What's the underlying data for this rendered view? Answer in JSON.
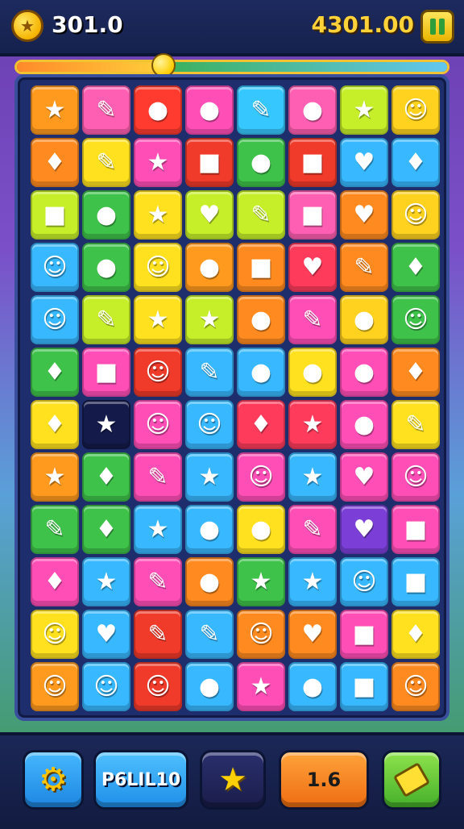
{
  "header": {
    "coin_icon": "star-coin-icon",
    "score_left": "301.0",
    "score_right": "4301.00",
    "pause_icon": "pause-icon"
  },
  "progress": {
    "value": 0.34
  },
  "board": {
    "columns": 8,
    "rows": 12,
    "tiles": [
      [
        {
          "color": "#ff9a1f",
          "icon": "★"
        },
        {
          "color": "#ff5fb2",
          "icon": "✎"
        },
        {
          "color": "#ff3b2f",
          "icon": "●"
        },
        {
          "color": "#ff4fb7",
          "icon": "●"
        },
        {
          "color": "#36c7ff",
          "icon": "✎"
        },
        {
          "color": "#ff5fb2",
          "icon": "●"
        },
        {
          "color": "#c6ef2a",
          "icon": "★"
        },
        {
          "color": "#ffd21f",
          "icon": "☺"
        }
      ],
      [
        {
          "color": "#ff8a1f",
          "icon": "♦"
        },
        {
          "color": "#ffe11f",
          "icon": "✎"
        },
        {
          "color": "#ff4fb7",
          "icon": "★"
        },
        {
          "color": "#f03a2a",
          "icon": "■"
        },
        {
          "color": "#3ec24a",
          "icon": "●"
        },
        {
          "color": "#f03a2a",
          "icon": "■"
        },
        {
          "color": "#38b8ff",
          "icon": "♥"
        },
        {
          "color": "#38b8ff",
          "icon": "♦"
        }
      ],
      [
        {
          "color": "#c6ef2a",
          "icon": "■"
        },
        {
          "color": "#3ec24a",
          "icon": "●"
        },
        {
          "color": "#ffe11f",
          "icon": "★"
        },
        {
          "color": "#c6ef2a",
          "icon": "♥"
        },
        {
          "color": "#c6ef2a",
          "icon": "✎"
        },
        {
          "color": "#ff5fb2",
          "icon": "■"
        },
        {
          "color": "#ff8a1f",
          "icon": "♥"
        },
        {
          "color": "#ffd21f",
          "icon": "☺"
        }
      ],
      [
        {
          "color": "#38b8ff",
          "icon": "☺"
        },
        {
          "color": "#3ec24a",
          "icon": "●"
        },
        {
          "color": "#ffe11f",
          "icon": "☺"
        },
        {
          "color": "#ff9a1f",
          "icon": "●"
        },
        {
          "color": "#ff8a1f",
          "icon": "■"
        },
        {
          "color": "#ff3b5c",
          "icon": "♥"
        },
        {
          "color": "#ff8a1f",
          "icon": "✎"
        },
        {
          "color": "#3ec24a",
          "icon": "♦"
        }
      ],
      [
        {
          "color": "#38b8ff",
          "icon": "☺"
        },
        {
          "color": "#c6ef2a",
          "icon": "✎"
        },
        {
          "color": "#ffe11f",
          "icon": "★"
        },
        {
          "color": "#c6ef2a",
          "icon": "★"
        },
        {
          "color": "#ff8a1f",
          "icon": "●"
        },
        {
          "color": "#ff4fb7",
          "icon": "✎"
        },
        {
          "color": "#ffd21f",
          "icon": "●"
        },
        {
          "color": "#3ec24a",
          "icon": "☺"
        }
      ],
      [
        {
          "color": "#3ec24a",
          "icon": "♦"
        },
        {
          "color": "#ff4fb7",
          "icon": "■"
        },
        {
          "color": "#f03a2a",
          "icon": "☺"
        },
        {
          "color": "#38b8ff",
          "icon": "✎"
        },
        {
          "color": "#38b8ff",
          "icon": "●"
        },
        {
          "color": "#ffe11f",
          "icon": "●"
        },
        {
          "color": "#ff4fb7",
          "icon": "●"
        },
        {
          "color": "#ff8a1f",
          "icon": "♦"
        }
      ],
      [
        {
          "color": "#ffe11f",
          "icon": "♦"
        },
        {
          "color": "#141a4a",
          "icon": "★"
        },
        {
          "color": "#ff4fb7",
          "icon": "☺"
        },
        {
          "color": "#38b8ff",
          "icon": "☺"
        },
        {
          "color": "#ff3b5c",
          "icon": "♦"
        },
        {
          "color": "#ff3b5c",
          "icon": "★"
        },
        {
          "color": "#ff4fb7",
          "icon": "●"
        },
        {
          "color": "#ffe11f",
          "icon": "✎"
        }
      ],
      [
        {
          "color": "#ff9a1f",
          "icon": "★"
        },
        {
          "color": "#3ec24a",
          "icon": "♦"
        },
        {
          "color": "#ff4fb7",
          "icon": "✎"
        },
        {
          "color": "#38b8ff",
          "icon": "★"
        },
        {
          "color": "#ff4fb7",
          "icon": "☺"
        },
        {
          "color": "#38b8ff",
          "icon": "★"
        },
        {
          "color": "#ff4fb7",
          "icon": "♥"
        },
        {
          "color": "#ff4fb7",
          "icon": "☺"
        }
      ],
      [
        {
          "color": "#3ec24a",
          "icon": "✎"
        },
        {
          "color": "#3ec24a",
          "icon": "♦"
        },
        {
          "color": "#38b8ff",
          "icon": "★"
        },
        {
          "color": "#38b8ff",
          "icon": "●"
        },
        {
          "color": "#ffe11f",
          "icon": "●"
        },
        {
          "color": "#ff4fb7",
          "icon": "✎"
        },
        {
          "color": "#7b3fd8",
          "icon": "♥"
        },
        {
          "color": "#ff4fb7",
          "icon": "■"
        }
      ],
      [
        {
          "color": "#ff4fb7",
          "icon": "♦"
        },
        {
          "color": "#38b8ff",
          "icon": "★"
        },
        {
          "color": "#ff4fb7",
          "icon": "✎"
        },
        {
          "color": "#ff8a1f",
          "icon": "●"
        },
        {
          "color": "#3ec24a",
          "icon": "★"
        },
        {
          "color": "#38b8ff",
          "icon": "★"
        },
        {
          "color": "#38b8ff",
          "icon": "☺"
        },
        {
          "color": "#38b8ff",
          "icon": "■"
        }
      ],
      [
        {
          "color": "#ffe11f",
          "icon": "☺"
        },
        {
          "color": "#38b8ff",
          "icon": "♥"
        },
        {
          "color": "#f03a2a",
          "icon": "✎"
        },
        {
          "color": "#38b8ff",
          "icon": "✎"
        },
        {
          "color": "#ff8a1f",
          "icon": "☺"
        },
        {
          "color": "#ff8a1f",
          "icon": "♥"
        },
        {
          "color": "#ff4fb7",
          "icon": "■"
        },
        {
          "color": "#ffe11f",
          "icon": "♦"
        }
      ],
      [
        {
          "color": "#ff9a1f",
          "icon": "☺"
        },
        {
          "color": "#38b8ff",
          "icon": "☺"
        },
        {
          "color": "#f03a2a",
          "icon": "☺"
        },
        {
          "color": "#38b8ff",
          "icon": "●"
        },
        {
          "color": "#ff4fb7",
          "icon": "★"
        },
        {
          "color": "#38b8ff",
          "icon": "●"
        },
        {
          "color": "#38b8ff",
          "icon": "■"
        },
        {
          "color": "#ff8a1f",
          "icon": "☺"
        }
      ]
    ]
  },
  "footer": {
    "settings_icon": "gear-icon",
    "label_button": "P6LIL10",
    "star_icon": "star-icon",
    "count_button": "1.6",
    "boost_icon": "ticket-icon"
  }
}
